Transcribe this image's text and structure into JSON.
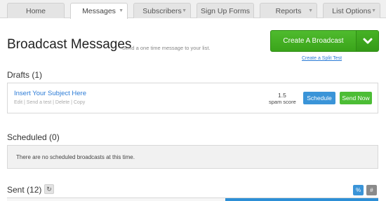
{
  "nav": {
    "tabs": [
      {
        "label": "Home"
      },
      {
        "label": "Messages"
      },
      {
        "label": "Subscribers"
      },
      {
        "label": "Sign Up Forms"
      },
      {
        "label": "Reports"
      },
      {
        "label": "List Options"
      }
    ]
  },
  "header": {
    "title": "Broadcast Messages",
    "subtitle": "Send a one time message to your list.",
    "create_button": "Create A Broadcast",
    "split_link": "Create a Split Test"
  },
  "drafts": {
    "title": "Drafts (1)",
    "item": {
      "subject": "Insert Your Subject Here",
      "actions": [
        "Edit",
        "Send a test",
        "Delete",
        "Copy"
      ],
      "spam_score": "1.5",
      "spam_label": "spam score",
      "schedule_label": "Schedule",
      "send_label": "Send Now"
    }
  },
  "scheduled": {
    "title": "Scheduled (0)",
    "empty_message": "There are no scheduled broadcasts at this time."
  },
  "sent": {
    "title": "Sent (12)",
    "refresh_glyph": "↻",
    "toggle_percent": "%",
    "toggle_number": "#"
  },
  "colors": {
    "green": "#3aa41a",
    "blue": "#3a94d8",
    "link": "#2b7bd6"
  }
}
